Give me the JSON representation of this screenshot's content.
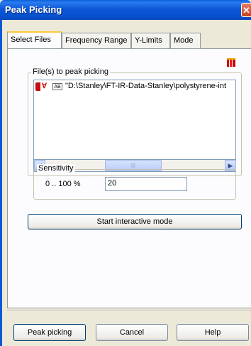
{
  "window": {
    "title": "Peak Picking",
    "close_glyph": "✕"
  },
  "tabs": [
    {
      "label": "Select Files",
      "active": true
    },
    {
      "label": "Frequency Range",
      "active": false
    },
    {
      "label": "Y-Limits",
      "active": false
    },
    {
      "label": "Mode",
      "active": false
    }
  ],
  "files_group": {
    "label": "File(s) to peak picking",
    "items": [
      {
        "badge": "AB",
        "text": "\"D:\\Stanley\\FT-IR-Data-Stanley\\polystyrene-int"
      }
    ],
    "scrollbar": {
      "left_arrow": "◀",
      "right_arrow": "▶",
      "thumb_grip": "|||"
    }
  },
  "sensitivity": {
    "label": "Sensitivity",
    "range_label": "0 .. 100 %",
    "value": "20"
  },
  "buttons": {
    "interactive": "Start interactive mode",
    "peak_picking": "Peak picking",
    "cancel": "Cancel",
    "help": "Help"
  }
}
